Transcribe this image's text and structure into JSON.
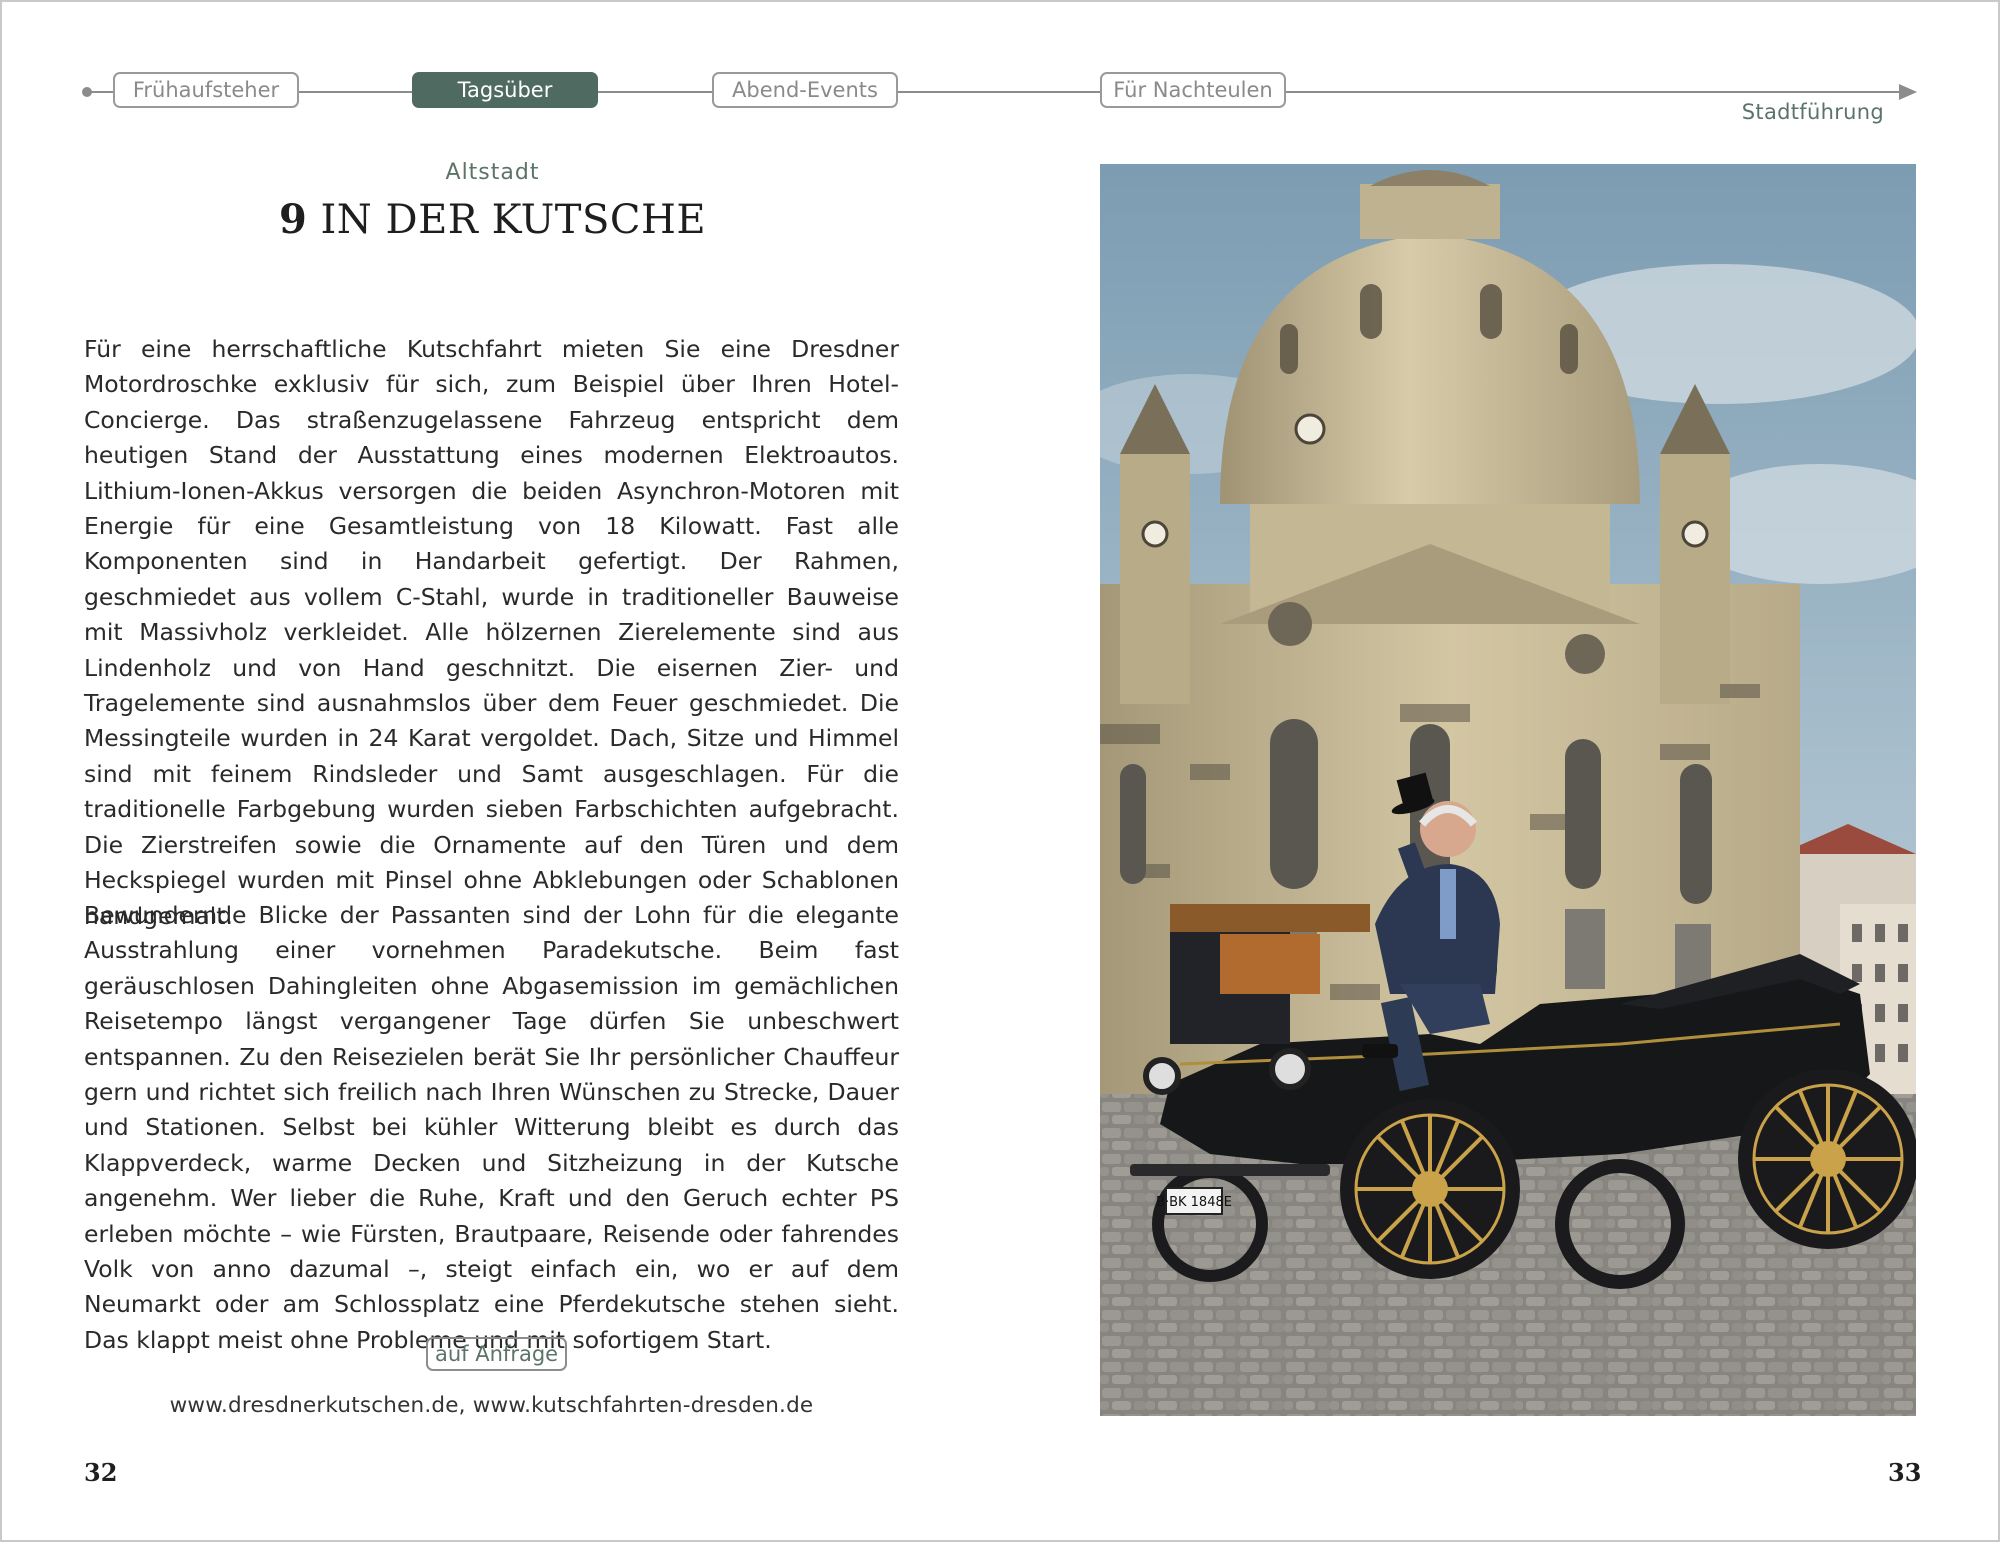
{
  "nav": {
    "tabs": [
      {
        "label": "Frühaufsteher",
        "active": false
      },
      {
        "label": "Tagsüber",
        "active": true
      },
      {
        "label": "Abend-Events",
        "active": false
      },
      {
        "label": "Für Nachteulen",
        "active": false
      }
    ],
    "category": "Stadtführung"
  },
  "article": {
    "location": "Altstadt",
    "number": "9",
    "title": "IN DER KUTSCHE",
    "paragraphs": [
      "Für eine herrschaftliche Kutschfahrt mieten Sie eine Dresdner Motordroschke exklusiv für sich, zum Beispiel über Ihren Hotel-Concierge. Das straßenzugelassene Fahrzeug entspricht dem heutigen Stand der Ausstattung eines modernen Elektroautos. Lithium-Ionen-Akkus versorgen die beiden Asynchron-Motoren mit Energie für eine Gesamtleistung von 18 Kilowatt. Fast alle Komponenten sind in Handarbeit gefertigt. Der Rahmen, geschmiedet aus vollem C-Stahl, wurde in traditioneller Bauweise mit Massivholz verkleidet. Alle hölzernen Zierelemente sind aus Lindenholz und von Hand geschnitzt. Die eisernen Zier- und Tragelemente sind ausnahmslos über dem Feuer geschmiedet. Die Messingteile wurden in 24 Karat vergoldet. Dach, Sitze und Himmel sind mit feinem Rindsleder und Samt ausgeschlagen. Für die traditionelle Farbgebung wurden sieben Farbschichten aufgebracht. Die Zierstreifen sowie die Ornamente auf den Türen und dem Heckspiegel wurden mit Pinsel ohne Abklebungen oder Schablonen handgemalt.",
      "Bewundernde Blicke der Passanten sind der Lohn für die elegante Ausstrahlung einer vornehmen Paradekutsche. Beim fast geräuschlosen Dahingleiten ohne Abgasemission im gemächlichen Reisetempo längst vergangener Tage dürfen Sie unbeschwert entspannen. Zu den Reisezielen berät Sie Ihr persönlicher Chauffeur gern und richtet sich freilich nach Ihren Wünschen zu Strecke, Dauer und Stationen. Selbst bei kühler Witterung bleibt es durch das Klappverdeck, warme Decken und Sitzheizung in der Kutsche angenehm. Wer lieber die Ruhe, Kraft und den Geruch echter PS erleben möchte – wie Fürsten, Brautpaare, Reisende oder fahrendes Volk von anno dazumal –, steigt einfach ein, wo er auf dem Neumarkt oder am Schlossplatz eine Pferdekutsche stehen sieht. Das klappt meist ohne Probleme und mit sofortigem Start."
    ],
    "price_badge": "auf Anfrage",
    "urls": "www.dresdnerkutschen.de, www.kutschfahrten-dresden.de"
  },
  "photo": {
    "license_plate": "B·BK 1848E"
  },
  "page_numbers": {
    "left": "32",
    "right": "33"
  },
  "colors": {
    "accent": "#4f6a60",
    "accent_text": "#5c7468",
    "rule": "#8c8c8c"
  }
}
